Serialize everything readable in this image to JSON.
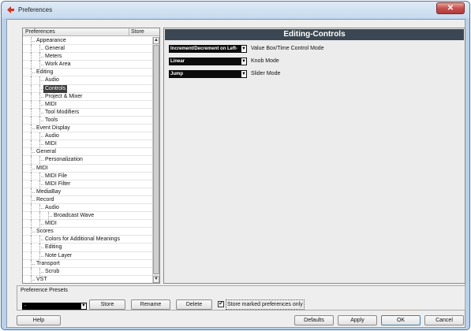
{
  "window": {
    "title": "Preferences",
    "close_label": "✕"
  },
  "tree": {
    "header_col1": "Preferences",
    "header_col2": "Store",
    "rows": [
      {
        "label": "Appearance",
        "depth": 0
      },
      {
        "label": "General",
        "depth": 1
      },
      {
        "label": "Meters",
        "depth": 1
      },
      {
        "label": "Work Area",
        "depth": 1
      },
      {
        "label": "Editing",
        "depth": 0
      },
      {
        "label": "Audio",
        "depth": 1
      },
      {
        "label": "Controls",
        "depth": 1,
        "selected": true
      },
      {
        "label": "Project & Mixer",
        "depth": 1
      },
      {
        "label": "MIDI",
        "depth": 1
      },
      {
        "label": "Tool Modifiers",
        "depth": 1
      },
      {
        "label": "Tools",
        "depth": 1
      },
      {
        "label": "Event Display",
        "depth": 0
      },
      {
        "label": "Audio",
        "depth": 1
      },
      {
        "label": "MIDI",
        "depth": 1
      },
      {
        "label": "General",
        "depth": 0
      },
      {
        "label": "Personalization",
        "depth": 1
      },
      {
        "label": "MIDI",
        "depth": 0
      },
      {
        "label": "MIDI File",
        "depth": 1
      },
      {
        "label": "MIDI Filter",
        "depth": 1
      },
      {
        "label": "MediaBay",
        "depth": 0
      },
      {
        "label": "Record",
        "depth": 0
      },
      {
        "label": "Audio",
        "depth": 1
      },
      {
        "label": "Broadcast Wave",
        "depth": 2
      },
      {
        "label": "MIDI",
        "depth": 1
      },
      {
        "label": "Scores",
        "depth": 0
      },
      {
        "label": "Colors for Additional Meanings",
        "depth": 1
      },
      {
        "label": "Editing",
        "depth": 1
      },
      {
        "label": "Note Layer",
        "depth": 1
      },
      {
        "label": "Transport",
        "depth": 0
      },
      {
        "label": "Scrub",
        "depth": 1
      },
      {
        "label": "VST",
        "depth": 0
      }
    ]
  },
  "panel": {
    "title": "Editing-Controls",
    "settings": [
      {
        "value": "Increment/Decrement on Left-",
        "label": "Value Box/Time Control Mode"
      },
      {
        "value": "Linear",
        "label": "Knob Mode"
      },
      {
        "value": "Jump",
        "label": "Slider Mode"
      }
    ]
  },
  "presets": {
    "label": "Preference Presets",
    "combo_value": "-",
    "store_button": "Store",
    "rename_button": "Rename",
    "delete_button": "Delete",
    "store_marked_label": "Store marked preferences only",
    "store_marked_checked": true
  },
  "footer": {
    "help_button": "Help",
    "defaults_button": "Defaults",
    "apply_button": "Apply",
    "ok_button": "OK",
    "cancel_button": "Cancel"
  },
  "colors": {
    "header_bar": "#3b4752",
    "window_frame": "#b9d1ea",
    "selected_row": "#3d3d3d"
  },
  "icons": {
    "app": "cubase-logo-icon",
    "close": "close-icon",
    "dropdown": "dropdown-arrow-icon",
    "scroll_up": "scroll-up-arrow-icon",
    "scroll_down": "scroll-down-arrow-icon",
    "check": "checkmark-icon"
  }
}
